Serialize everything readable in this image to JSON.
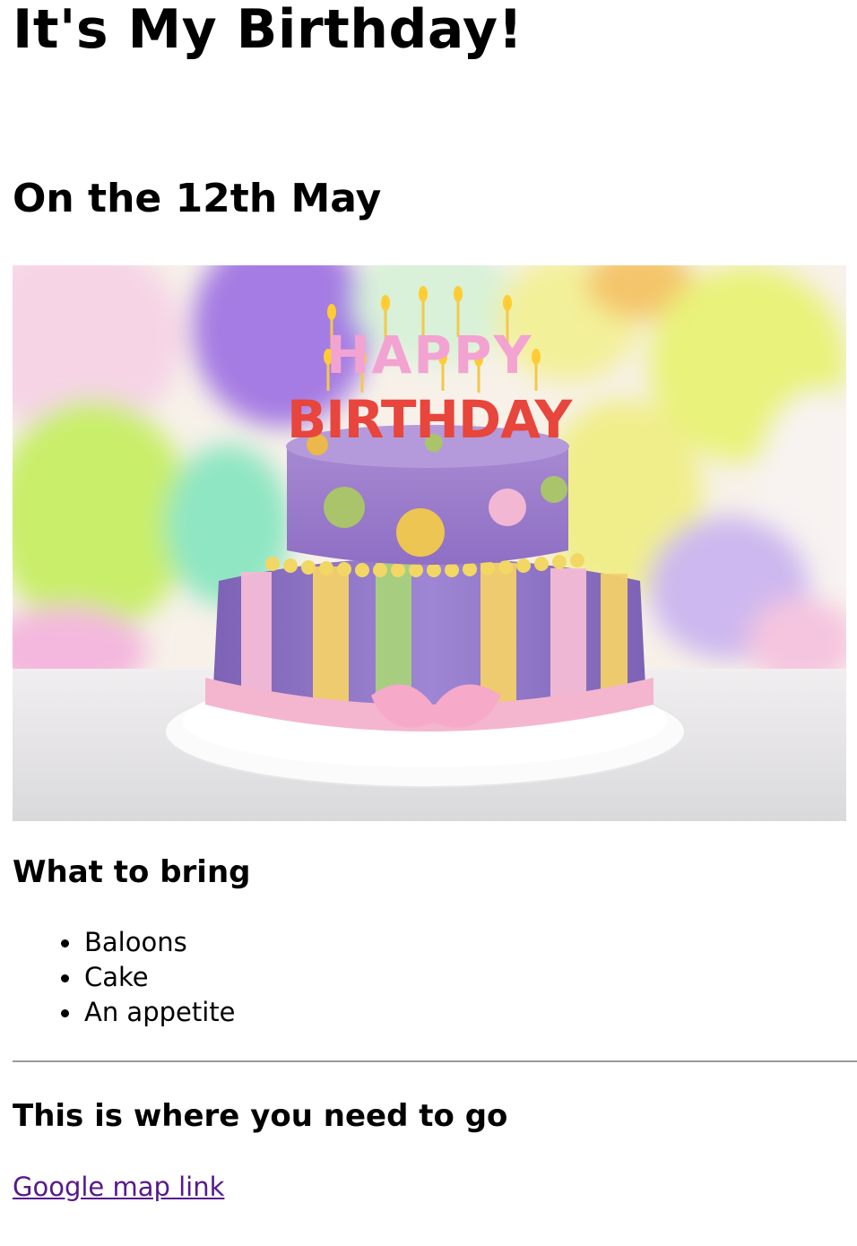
{
  "page": {
    "title": "It's My Birthday!",
    "date_heading": "On the 12th May",
    "bring_heading": "What to bring",
    "items": [
      "Baloons",
      "Cake",
      "An appetite"
    ],
    "where_heading": "This is where you need to go",
    "map_link_label": "Google map link"
  },
  "image": {
    "candle_text_top": "HAPPY",
    "candle_text_bottom": "BIRTHDAY"
  },
  "colors": {
    "link_visited": "#551a8b",
    "divider": "#9a9a9a"
  }
}
